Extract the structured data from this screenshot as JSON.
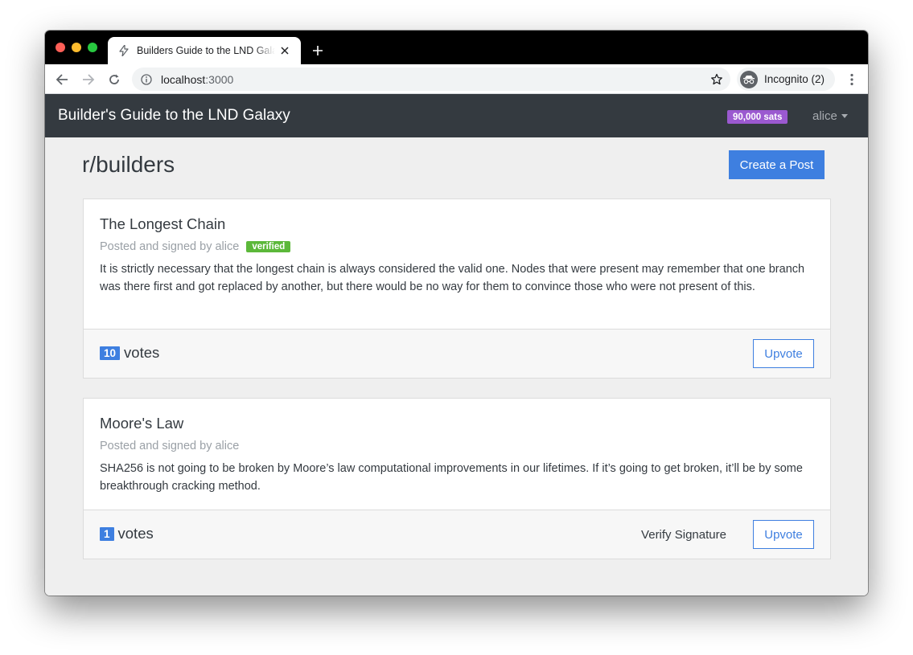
{
  "browser": {
    "tab_title": "Builders Guide to the LND Galaxy",
    "url_host": "localhost",
    "url_port": ":3000",
    "profile_label": "Incognito (2)",
    "icons": [
      "lightning-icon",
      "close-icon",
      "plus-icon",
      "back-icon",
      "forward-icon",
      "reload-icon",
      "info-icon",
      "star-icon",
      "incognito-icon",
      "more-vert-icon"
    ]
  },
  "navbar": {
    "brand": "Builder's Guide to the LND Galaxy",
    "balance": "90,000 sats",
    "user": "alice"
  },
  "page": {
    "title": "r/builders",
    "create_label": "Create a Post"
  },
  "posts": [
    {
      "title": "The Longest Chain",
      "meta": "Posted and signed by alice",
      "badge": "verified",
      "body": "It is strictly necessary that the longest chain is always considered the valid one. Nodes that were present may remember that one branch was there first and got replaced by another, but there would be no way for them to convince those who were not present of this.",
      "votes": "10",
      "votes_label": "votes",
      "upvote_label": "Upvote"
    },
    {
      "title": "Moore's Law",
      "meta": "Posted and signed by alice",
      "body": "SHA256 is not going to be broken by Moore’s law computational improvements in our lifetimes. If it’s going to get broken, it’ll be by some breakthrough cracking method.",
      "votes": "1",
      "votes_label": "votes",
      "verify_label": "Verify Signature",
      "upvote_label": "Upvote"
    }
  ],
  "colors": {
    "primary": "#3e7fe0",
    "navbar": "#343a40",
    "sats_badge": "#9b59d0",
    "verified": "#5cb83a"
  }
}
